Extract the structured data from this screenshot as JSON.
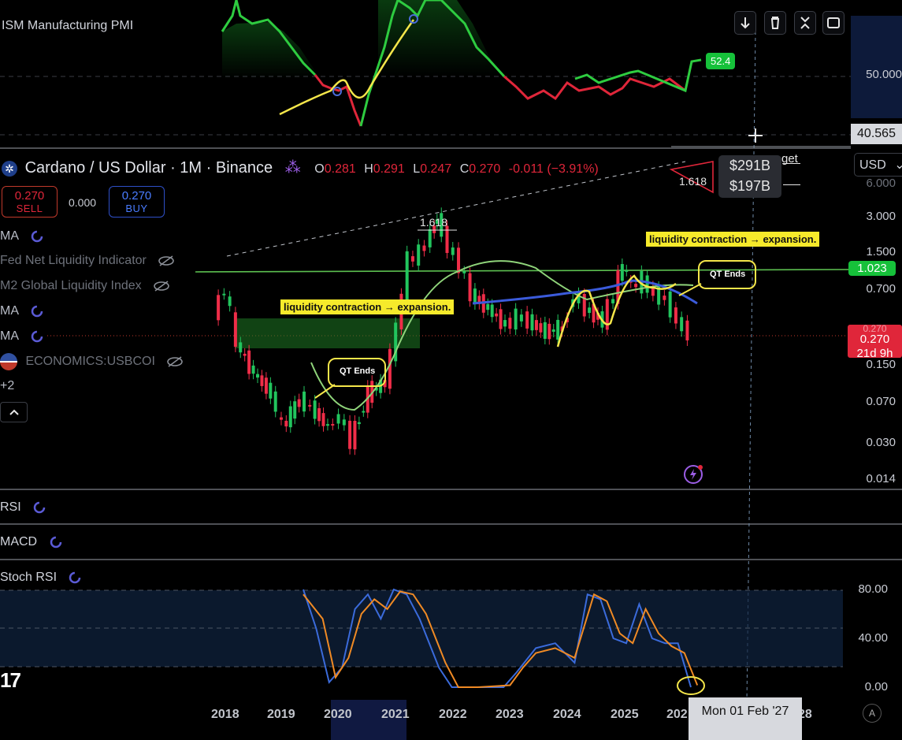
{
  "pmi_pane": {
    "title": "ISM Manufacturing PMI",
    "axis_labels": [
      "50.000",
      "40.565"
    ],
    "last_value": "52.4"
  },
  "toolbar": {
    "download_label": "↓",
    "delete_label": "🗑",
    "collapse_label": "✕",
    "maximize_label": "▢"
  },
  "header": {
    "symbol": "Cardano / US Dollar · 1M · Binance",
    "o_label": "O",
    "o_val": "0.281",
    "h_label": "H",
    "h_val": "0.291",
    "l_label": "L",
    "l_val": "0.247",
    "c_label": "C",
    "c_val": "0.270",
    "change": "-0.011 (−3.91%)"
  },
  "trade": {
    "sell_price": "0.270",
    "sell_label": "SELL",
    "spread": "0.000",
    "buy_price": "0.270",
    "buy_label": "BUY"
  },
  "indicators": {
    "ma1": "MA",
    "fed": "Fed Net Liquidity Indicator",
    "m2": "M2 Global Liquidity Index",
    "ma2": "MA",
    "ma3": "MA",
    "economics": "ECONOMICS:USBCOI",
    "more": "+2"
  },
  "currency": "USD",
  "price_axis": [
    "3.000",
    "1.500",
    "0.700",
    "0.150",
    "0.070",
    "0.030",
    "0.014"
  ],
  "price_axis_partial_top": "6.000",
  "line_tag": "1.023",
  "current_tag": {
    "price": "0.270",
    "countdown": "21d 9h",
    "hidden": "0.270"
  },
  "liquidity_box": {
    "top": "$291B",
    "bottom": "$197B",
    "side_text": "get",
    "ratio": "1.618"
  },
  "annotations": {
    "fib": "1.618",
    "banner1": "liquidity contraction → expansion.",
    "banner2": "liquidity contraction → expansion.",
    "qt1": "QT Ends",
    "qt2": "QT Ends"
  },
  "panes": {
    "rsi": "RSI",
    "macd": "MACD",
    "stoch": "Stoch RSI"
  },
  "stoch_axis": [
    "80.00",
    "40.00",
    "0.00"
  ],
  "x_axis": [
    "2018",
    "2019",
    "2020",
    "2021",
    "2022",
    "2023",
    "2024",
    "2025",
    "202",
    "28"
  ],
  "cursor_date": "Mon 01 Feb '27",
  "auto_label": "A",
  "logo": "17",
  "chart_data": {
    "type": "line",
    "title": "Cardano / US Dollar · 1M · Binance",
    "x": [
      "2018",
      "2019",
      "2020",
      "2021",
      "2022",
      "2023",
      "2024",
      "2025"
    ],
    "series": [
      {
        "points": [
          [
            2017.8,
            0.4
          ],
          [
            2018.0,
            0.7
          ],
          [
            2018.2,
            0.22
          ],
          [
            2018.5,
            0.12
          ],
          [
            2018.8,
            0.08
          ],
          [
            2019.0,
            0.04
          ],
          [
            2019.3,
            0.07
          ],
          [
            2019.5,
            0.06
          ],
          [
            2019.8,
            0.04
          ],
          [
            2020.0,
            0.05
          ],
          [
            2020.2,
            0.03
          ],
          [
            2020.5,
            0.08
          ],
          [
            2020.8,
            0.1
          ],
          [
            2021.0,
            0.3
          ],
          [
            2021.2,
            1.2
          ],
          [
            2021.4,
            1.4
          ],
          [
            2021.6,
            2.1
          ],
          [
            2021.7,
            2.9
          ],
          [
            2021.9,
            1.6
          ],
          [
            2022.1,
            1.1
          ],
          [
            2022.3,
            0.6
          ],
          [
            2022.6,
            0.45
          ],
          [
            2022.9,
            0.32
          ],
          [
            2023.1,
            0.38
          ],
          [
            2023.3,
            0.35
          ],
          [
            2023.6,
            0.28
          ],
          [
            2023.9,
            0.3
          ],
          [
            2024.1,
            0.6
          ],
          [
            2024.3,
            0.45
          ],
          [
            2024.6,
            0.35
          ],
          [
            2024.8,
            0.6
          ],
          [
            2024.95,
            1.1
          ],
          [
            2025.1,
            0.7
          ],
          [
            2025.3,
            0.8
          ],
          [
            2025.5,
            0.6
          ],
          [
            2025.7,
            0.55
          ],
          [
            2025.9,
            0.35
          ],
          [
            2026.1,
            0.27
          ]
        ]
      }
    ],
    "stoch_rsi": {
      "k": [
        [
          2019.3,
          100
        ],
        [
          2019.5,
          60
        ],
        [
          2019.7,
          5
        ],
        [
          2019.9,
          20
        ],
        [
          2020.1,
          80
        ],
        [
          2020.3,
          95
        ],
        [
          2020.5,
          70
        ],
        [
          2020.7,
          100
        ],
        [
          2020.9,
          95
        ],
        [
          2021.1,
          70
        ],
        [
          2021.4,
          20
        ],
        [
          2021.6,
          0
        ],
        [
          2022.0,
          0
        ],
        [
          2022.4,
          0
        ],
        [
          2022.6,
          15
        ],
        [
          2022.9,
          40
        ],
        [
          2023.2,
          45
        ],
        [
          2023.5,
          25
        ],
        [
          2023.7,
          95
        ],
        [
          2023.9,
          90
        ],
        [
          2024.1,
          50
        ],
        [
          2024.3,
          45
        ],
        [
          2024.5,
          85
        ],
        [
          2024.7,
          50
        ],
        [
          2024.9,
          45
        ],
        [
          2025.1,
          45
        ],
        [
          2025.3,
          0
        ]
      ],
      "d": [
        [
          2019.3,
          95
        ],
        [
          2019.6,
          70
        ],
        [
          2019.8,
          10
        ],
        [
          2020.0,
          30
        ],
        [
          2020.2,
          75
        ],
        [
          2020.4,
          90
        ],
        [
          2020.6,
          80
        ],
        [
          2020.8,
          98
        ],
        [
          2021.0,
          95
        ],
        [
          2021.2,
          75
        ],
        [
          2021.5,
          25
        ],
        [
          2021.7,
          0
        ],
        [
          2022.0,
          0
        ],
        [
          2022.5,
          2
        ],
        [
          2022.7,
          20
        ],
        [
          2022.9,
          35
        ],
        [
          2023.2,
          40
        ],
        [
          2023.5,
          30
        ],
        [
          2023.8,
          95
        ],
        [
          2024.0,
          88
        ],
        [
          2024.2,
          55
        ],
        [
          2024.4,
          45
        ],
        [
          2024.6,
          80
        ],
        [
          2024.8,
          55
        ],
        [
          2025.0,
          42
        ],
        [
          2025.2,
          35
        ],
        [
          2025.4,
          2
        ]
      ],
      "ylim": [
        0,
        100
      ]
    },
    "ylim": [
      0.014,
      6.0
    ],
    "scale": "log"
  }
}
